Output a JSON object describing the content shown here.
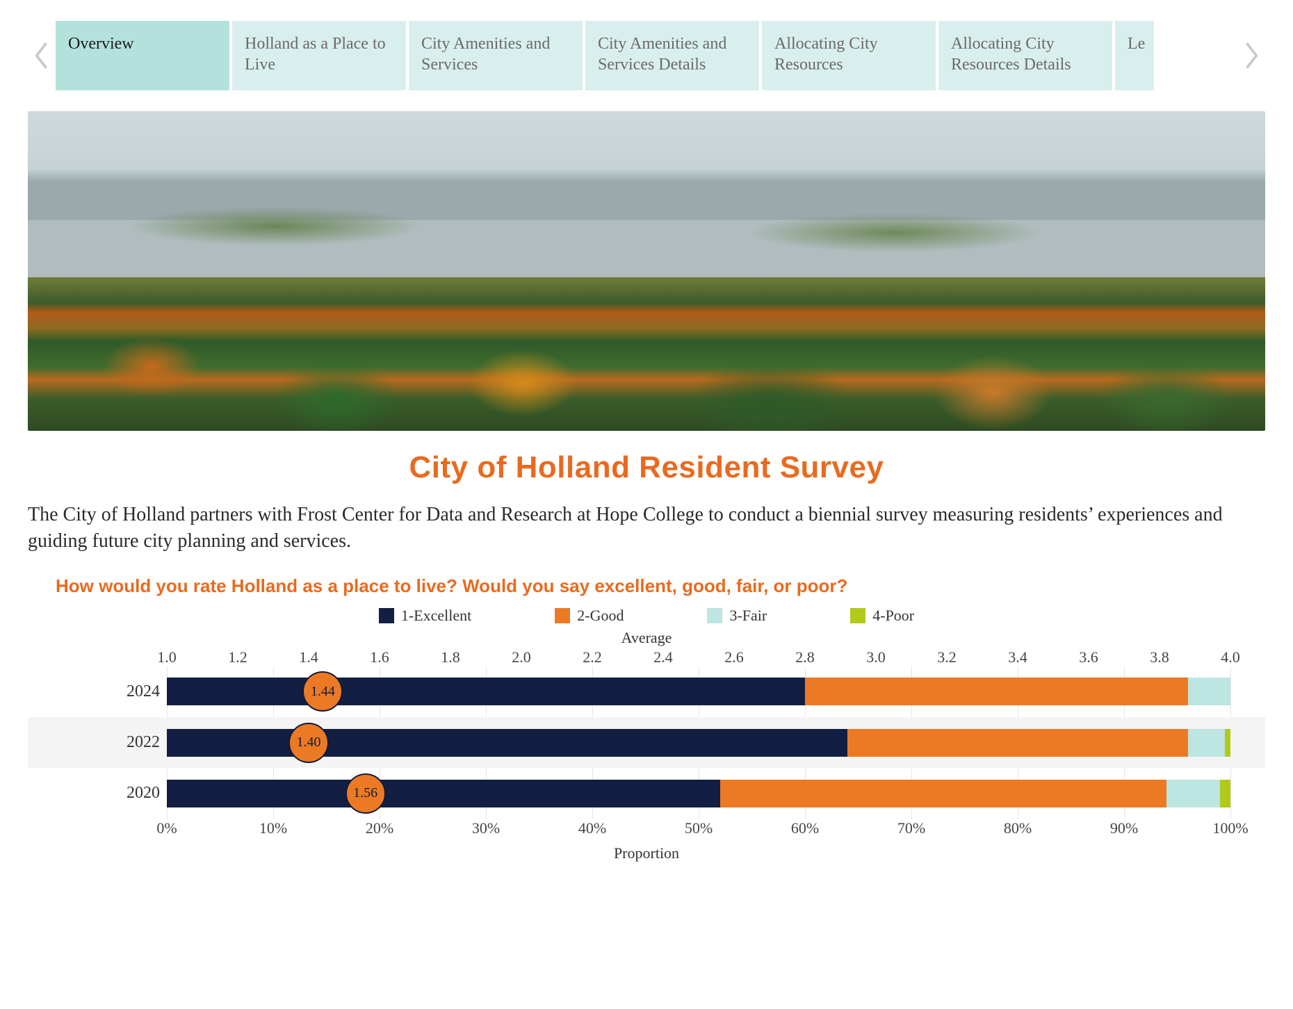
{
  "tabs": {
    "items": [
      {
        "label": "Overview",
        "active": true
      },
      {
        "label": "Holland as a Place to Live",
        "active": false
      },
      {
        "label": "City Amenities and Services",
        "active": false
      },
      {
        "label": "City Amenities and Services Details",
        "active": false
      },
      {
        "label": "Allocating City Resources",
        "active": false
      },
      {
        "label": "Allocating City Resources Details",
        "active": false
      },
      {
        "label": "Le",
        "active": false,
        "partial": true
      }
    ]
  },
  "title": "City of Holland Resident Survey",
  "intro": "The City of Holland partners with Frost Center for Data and Research at Hope College to conduct a biennial survey measuring residents’ experiences and guiding future city planning and services.",
  "question": "How would you rate Holland as a place to live? Would you say excellent, good, fair, or poor?",
  "legend": [
    {
      "label": "1-Excellent",
      "color": "#121f42"
    },
    {
      "label": "2-Good",
      "color": "#ec7a24"
    },
    {
      "label": "3-Fair",
      "color": "#bde5e1"
    },
    {
      "label": "4-Poor",
      "color": "#b3c91a"
    }
  ],
  "axis_top": {
    "title": "Average",
    "min": 1.0,
    "max": 4.0,
    "step": 0.2,
    "ticks": [
      "1.0",
      "1.2",
      "1.4",
      "1.6",
      "1.8",
      "2.0",
      "2.2",
      "2.4",
      "2.6",
      "2.8",
      "3.0",
      "3.2",
      "3.4",
      "3.6",
      "3.8",
      "4.0"
    ]
  },
  "axis_bottom": {
    "title": "Proportion",
    "min": 0,
    "max": 100,
    "step": 10,
    "ticks": [
      "0%",
      "10%",
      "20%",
      "30%",
      "40%",
      "50%",
      "60%",
      "70%",
      "80%",
      "90%",
      "100%"
    ]
  },
  "chart_data": {
    "type": "bar",
    "stacked": true,
    "orientation": "horizontal",
    "x_axis_bottom": {
      "label": "Proportion",
      "min": 0,
      "max": 100,
      "unit": "%"
    },
    "x_axis_top": {
      "label": "Average",
      "min": 1.0,
      "max": 4.0
    },
    "categories": [
      "2024",
      "2022",
      "2020"
    ],
    "series": [
      {
        "name": "1-Excellent",
        "color": "#121f42",
        "values": [
          60,
          64,
          52
        ]
      },
      {
        "name": "2-Good",
        "color": "#ec7a24",
        "values": [
          36,
          32,
          42
        ]
      },
      {
        "name": "3-Fair",
        "color": "#bde5e1",
        "values": [
          4,
          3.5,
          5
        ]
      },
      {
        "name": "4-Poor",
        "color": "#b3c91a",
        "values": [
          0,
          0.5,
          1
        ]
      }
    ],
    "averages": [
      1.44,
      1.4,
      1.56
    ]
  }
}
